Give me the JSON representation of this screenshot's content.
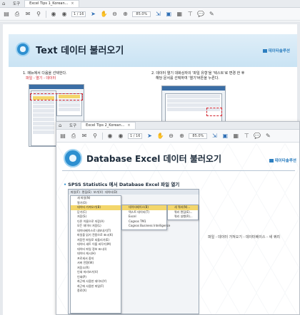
{
  "back_window": {
    "tabbar": {
      "tools_label": "도구",
      "tab_label": "Excel Tips 1_Korean...",
      "close": "×"
    },
    "toolbar": {
      "page_label": "1 / 16",
      "zoom_label": "85.0%"
    },
    "banner": {
      "title": "Text 데이터 불러오기",
      "brand": "데이타솔루션"
    },
    "step1": {
      "text": "1. 메뉴에서 다음을 선택한다.",
      "path": "파일 - 열기 - 데이터"
    },
    "step2": {
      "line1": "2. 데이터 열기 대화상자의 '파일 유형'을 '텍스트'로 변경 한 후",
      "line2": "해당 문서를 선택하여 '열기'버튼을 누른다."
    }
  },
  "front_window": {
    "tabbar": {
      "tools_label": "도구",
      "tab_label": "Excel Tips 2_Korean...",
      "close": "×"
    },
    "toolbar": {
      "page_label": "1 / 16",
      "zoom_label": "85.0%"
    },
    "banner": {
      "title": "Database Excel 데이터 불러오기",
      "brand": "데이타솔루션"
    },
    "section": "SPSS Statistics 에서 Database Excel 파일 열기",
    "caption": "파일 - 데이터 가져오기 - 데이터베이스 - 새 쿼리",
    "menu": {
      "bar": [
        "파일(F)",
        "편집(E)",
        "보기(V)",
        "데이터(D)"
      ],
      "items": [
        "새 파일(N)",
        "열기(O)",
        "데이터 가져오기(B)",
        "닫기(C)",
        "저장(S)",
        "다른 이름으로 저장(A)",
        "모든 데이터 저장(L)",
        "데이터베이스로 내보내기(T)",
        "파일을 읽기 전용으로 표시(K)",
        "저장된 파일로 되돌리기(E)",
        "데이터 세트 이름 바꾸기(M)",
        "데이터 파일 정보 표시(I)",
        "데이터 캐시(H)",
        "프로세서 중지",
        "서버 전환(W)",
        "저장소(R)",
        "인쇄 미리보기(V)",
        "인쇄(P)",
        "최근에 사용한 데이터(Y)",
        "최근에 사용한 파일(F)",
        "종료(X)"
      ],
      "submenu": [
        "데이터베이스(B)",
        "텍스트 데이터(T)",
        "Excel",
        "Cognos TM1",
        "Cognos Business Intelligence"
      ],
      "submenu2": [
        "새 쿼리(N)...",
        "쿼리 편집(E)...",
        "쿼리 실행(R)..."
      ]
    }
  }
}
